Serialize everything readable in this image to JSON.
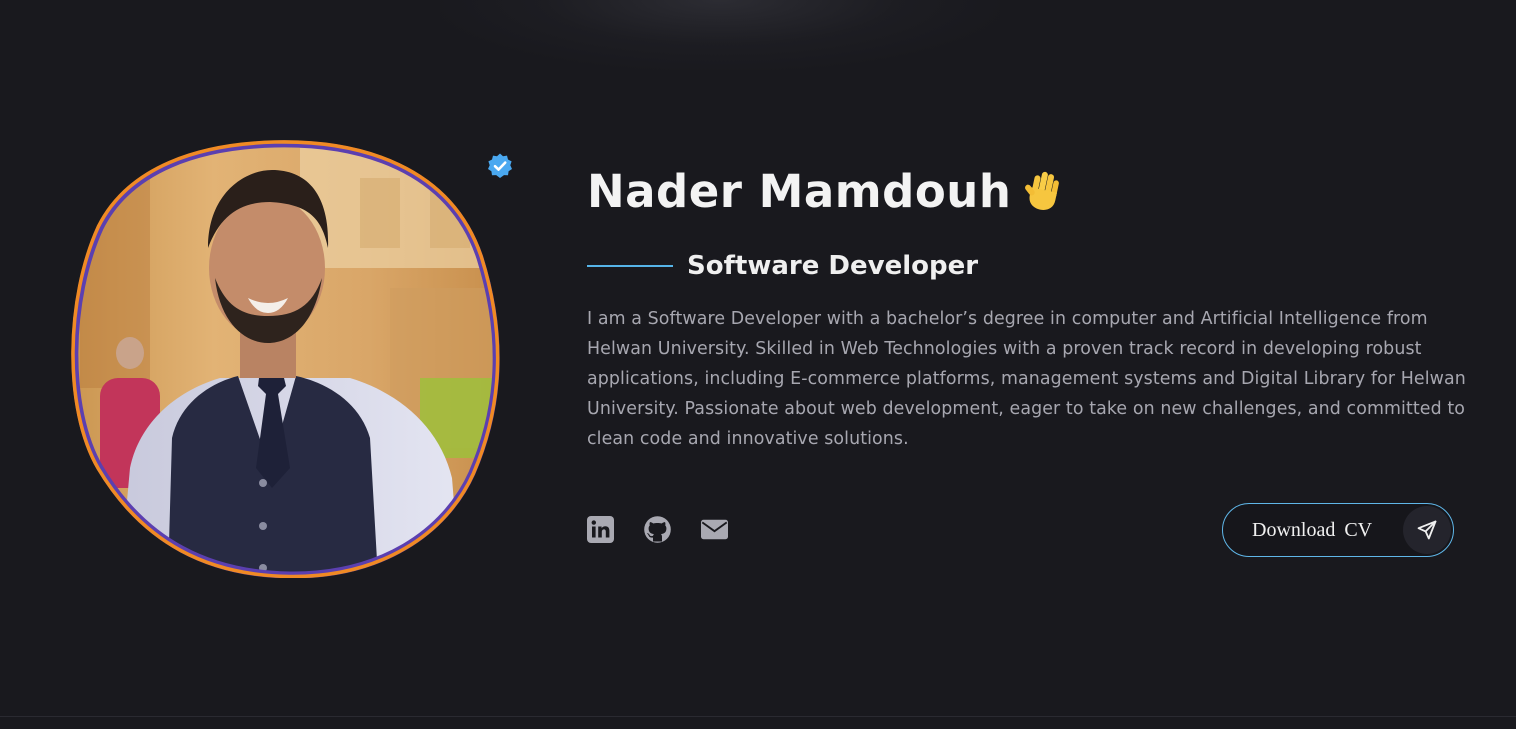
{
  "profile": {
    "name": "Nader Mamdouh",
    "role": "Software Developer",
    "bio": "I am a Software Developer with a bachelor’s degree in computer and Artificial Intelligence from Helwan University. Skilled in Web Technologies with a proven track record in developing robust applications, including E-commerce platforms, management systems and Digital Library for Helwan University. Passionate about web development, eager to take on new challenges, and committed to clean code and innovative solutions.",
    "greeting_icon": "waving-hand-icon",
    "verified_icon": "verified-badge-icon"
  },
  "socials": [
    {
      "icon": "linkedin-icon"
    },
    {
      "icon": "github-icon"
    },
    {
      "icon": "envelope-icon"
    }
  ],
  "cv_button": {
    "label": "Download  CV",
    "icon": "send-icon"
  },
  "colors": {
    "background": "#19191e",
    "accent_blue": "#56b4e9",
    "avatar_border": "#f08a24",
    "avatar_inner_border": "#5b3fb0",
    "verified": "#4aa8f0",
    "text_muted": "#a7a7b0",
    "icon_gray": "#a9a9b2"
  }
}
